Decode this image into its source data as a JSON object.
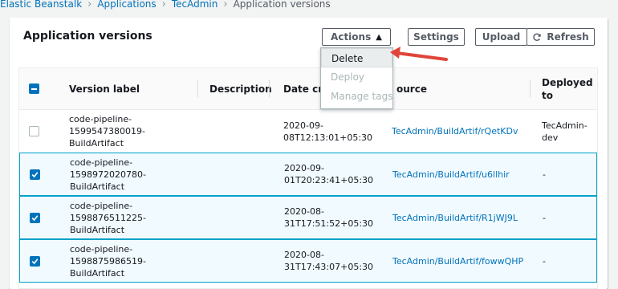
{
  "breadcrumb": {
    "items": [
      "Elastic Beanstalk",
      "Applications",
      "TecAdmin"
    ],
    "current": "Application versions"
  },
  "panel": {
    "title": "Application versions",
    "buttons": {
      "actions": "Actions",
      "settings": "Settings",
      "upload": "Upload",
      "refresh": "Refresh"
    },
    "actions_menu": {
      "items": [
        "Delete",
        "Deploy",
        "Manage tags"
      ],
      "disabled": [
        false,
        true,
        true
      ]
    }
  },
  "table": {
    "columns": {
      "version_label": "Version label",
      "description": "Description",
      "date_created": "Date crea",
      "source": "ource",
      "deployed_to": "Deployed to"
    },
    "rows": [
      {
        "checked": false,
        "version_label": "code-pipeline-1599547380019-BuildArtifact",
        "label_lines": [
          "code-pipeline-",
          "1599547380019-",
          "BuildArtifact"
        ],
        "date_lines": [
          "2020-09-",
          "08T12:13:01+05:30"
        ],
        "source": "TecAdmin/BuildArtif/rQetKDv",
        "deployed_lines": [
          "TecAdmin-",
          "dev"
        ]
      },
      {
        "checked": true,
        "version_label": "code-pipeline-1598972020780-BuildArtifact",
        "label_lines": [
          "code-pipeline-",
          "1598972020780-",
          "BuildArtifact"
        ],
        "date_lines": [
          "2020-09-",
          "01T20:23:41+05:30"
        ],
        "source": "TecAdmin/BuildArtif/u6llhir",
        "deployed_lines": [
          "-"
        ]
      },
      {
        "checked": true,
        "version_label": "code-pipeline-1598876511225-BuildArtifact",
        "label_lines": [
          "code-pipeline-",
          "1598876511225-",
          "BuildArtifact"
        ],
        "date_lines": [
          "2020-08-",
          "31T17:51:52+05:30"
        ],
        "source": "TecAdmin/BuildArtif/R1jWJ9L",
        "deployed_lines": [
          "-"
        ]
      },
      {
        "checked": true,
        "version_label": "code-pipeline-1598875986519-BuildArtifact",
        "label_lines": [
          "code-pipeline-",
          "1598875986519-",
          "BuildArtifact"
        ],
        "date_lines": [
          "2020-08-",
          "31T17:43:07+05:30"
        ],
        "source": "TecAdmin/BuildArtif/fowwQHP",
        "deployed_lines": [
          "-"
        ]
      }
    ]
  },
  "colors": {
    "link": "#0073bb",
    "selected_border": "#00a1c9",
    "selected_bg": "#f1faff",
    "annotation_arrow": "#e0453a"
  }
}
